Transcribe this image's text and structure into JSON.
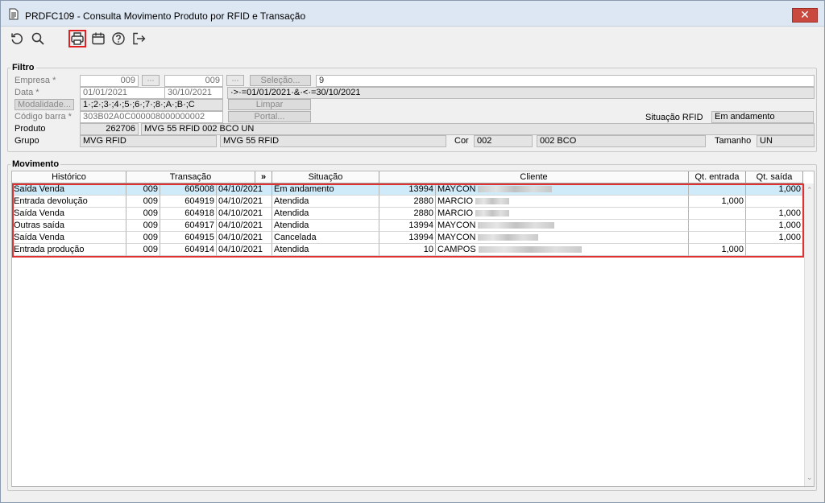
{
  "window": {
    "title": "PRDFC109 - Consulta Movimento Produto por RFID e Transação",
    "close_label": "✕"
  },
  "toolbar": {
    "icons": [
      "refresh-icon",
      "search-icon",
      "print-icon",
      "calendar-icon",
      "help-icon",
      "exit-icon"
    ]
  },
  "filtro": {
    "legend": "Filtro",
    "empresa_label": "Empresa *",
    "empresa_from": "009",
    "empresa_to": "009",
    "selecao_label": "Seleção...",
    "selecao_value": "9",
    "data_label": "Data *",
    "data_from": "01/01/2021",
    "data_to": "30/10/2021",
    "data_expr": "·>·=01/01/2021·&·<·=30/10/2021",
    "modalidade_label": "Modalidade...",
    "modalidade_value": "1·;2·;3·;4·;5·;6·;7·;8·;A·;B·;C",
    "limpar_label": "Limpar",
    "codigo_label": "Código barra *",
    "codigo_value": "303B02A0C000008000000002",
    "portal_label": "Portal...",
    "situacao_label": "Situação RFID",
    "situacao_value": "Em andamento",
    "produto_label": "Produto",
    "produto_code": "262706",
    "produto_desc": "MVG 55 RFID 002 BCO UN",
    "grupo_label": "Grupo",
    "grupo_code": "MVG RFID",
    "grupo_desc": "MVG 55 RFID",
    "cor_label": "Cor",
    "cor_code": "002",
    "cor_desc": "002 BCO",
    "tamanho_label": "Tamanho",
    "tamanho_value": "UN"
  },
  "movimento": {
    "legend": "Movimento",
    "columns": {
      "historico": "Histórico",
      "transacao": "Transação",
      "expand": "»",
      "situacao": "Situação",
      "cliente": "Cliente",
      "qt_entrada": "Qt. entrada",
      "qt_saida": "Qt. saída"
    },
    "rows": [
      {
        "historico": "Saída Venda",
        "emp": "009",
        "num": "605008",
        "data": "04/10/2021",
        "situacao": "Em andamento",
        "cli_cod": "13994",
        "cli_nome": "MAYCON",
        "qt_entrada": "",
        "qt_saida": "1,000"
      },
      {
        "historico": "Entrada devolução",
        "emp": "009",
        "num": "604919",
        "data": "04/10/2021",
        "situacao": "Atendida",
        "cli_cod": "2880",
        "cli_nome": "MARCIO",
        "qt_entrada": "1,000",
        "qt_saida": ""
      },
      {
        "historico": "Saída Venda",
        "emp": "009",
        "num": "604918",
        "data": "04/10/2021",
        "situacao": "Atendida",
        "cli_cod": "2880",
        "cli_nome": "MARCIO",
        "qt_entrada": "",
        "qt_saida": "1,000"
      },
      {
        "historico": "Outras saída",
        "emp": "009",
        "num": "604917",
        "data": "04/10/2021",
        "situacao": "Atendida",
        "cli_cod": "13994",
        "cli_nome": "MAYCON",
        "qt_entrada": "",
        "qt_saida": "1,000"
      },
      {
        "historico": "Saída Venda",
        "emp": "009",
        "num": "604915",
        "data": "04/10/2021",
        "situacao": "Cancelada",
        "cli_cod": "13994",
        "cli_nome": "MAYCON",
        "qt_entrada": "",
        "qt_saida": "1,000"
      },
      {
        "historico": "Entrada produção",
        "emp": "009",
        "num": "604914",
        "data": "04/10/2021",
        "situacao": "Atendida",
        "cli_cod": "10",
        "cli_nome": "CAMPOS",
        "qt_entrada": "1,000",
        "qt_saida": ""
      }
    ]
  },
  "scrollbar": {
    "up": "⌃",
    "down": "⌄"
  }
}
